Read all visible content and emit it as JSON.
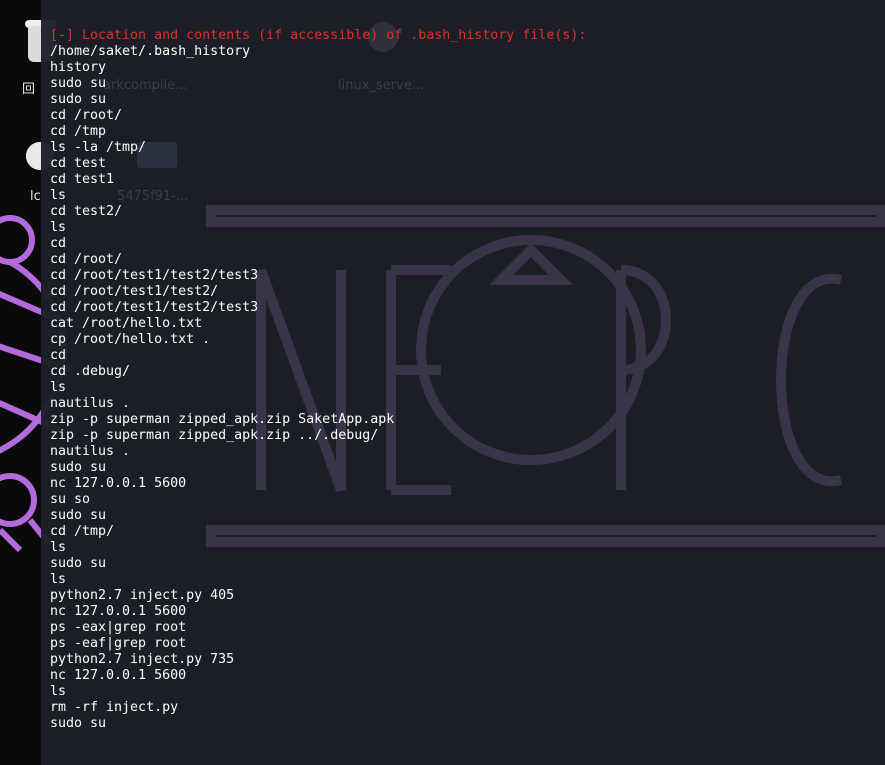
{
  "desktop": {
    "icons": [
      {
        "name": "trash-icon",
        "label": "回"
      },
      {
        "name": "gear-icon",
        "label": "lc"
      }
    ],
    "ghost_labels": [
      "arkcompile...",
      "linux_serve...",
      "5475f91-..."
    ]
  },
  "terminal": {
    "header": "[-] Location and contents (if accessible) of .bash_history file(s):",
    "path": "/home/saket/.bash_history",
    "history": [
      "history",
      "sudo su",
      "sudo su",
      "cd /root/",
      "cd /tmp",
      "ls -la /tmp/",
      "cd test",
      "cd test1",
      "ls",
      "cd test2/",
      "ls",
      "cd",
      "cd /root/",
      "cd /root/test1/test2/test3",
      "cd /root/test1/test2/",
      "cd /root/test1/test2/test3",
      "cat /root/hello.txt",
      "cp /root/hello.txt .",
      "cd",
      "cd .debug/",
      "ls",
      "nautilus .",
      "zip -p superman zipped_apk.zip SaketApp.apk",
      "zip -p superman zipped_apk.zip ../.debug/",
      "nautilus .",
      "sudo su",
      "nc 127.0.0.1 5600",
      "su so",
      "sudo su",
      "cd /tmp/",
      "ls",
      "sudo su",
      "ls",
      "python2.7 inject.py 405",
      "nc 127.0.0.1 5600",
      "ps -eax|grep root",
      "ps -eaf|grep root",
      "python2.7 inject.py 735",
      "nc 127.0.0.1 5600",
      "ls",
      "rm -rf inject.py",
      "sudo su"
    ]
  },
  "colors": {
    "terminal_bg": "#1c1f26",
    "text": "#ffffff",
    "warning": "#d9312b",
    "emblem": "#b36bdc",
    "watermark": "#3a3448"
  }
}
